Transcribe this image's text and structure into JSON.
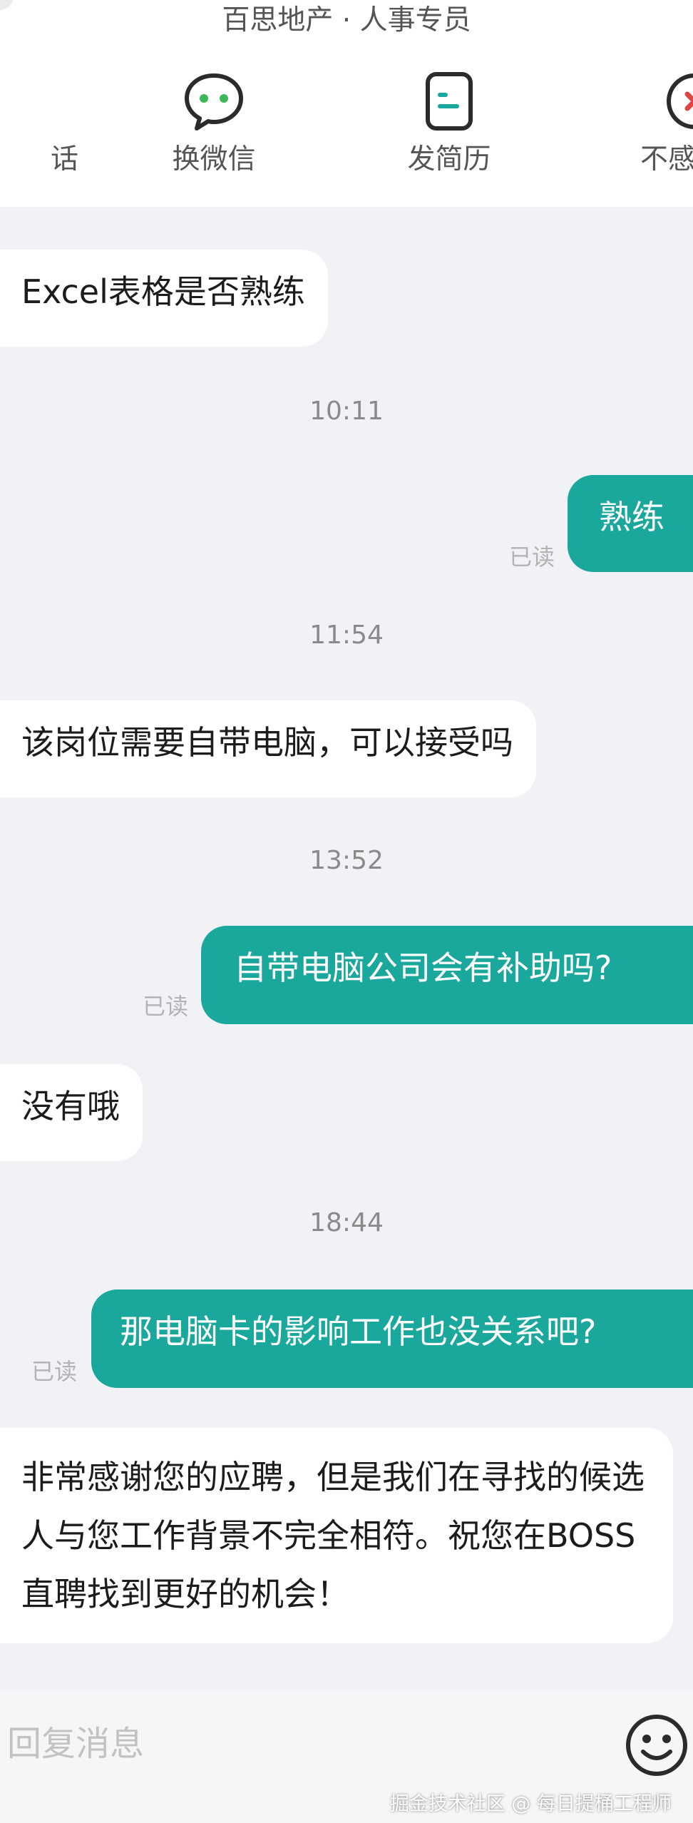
{
  "header": {
    "title": "百思地产 · 人事专员",
    "actions": [
      {
        "label": "话",
        "icon": "phone-icon"
      },
      {
        "label": "换微信",
        "icon": "wechat-icon"
      },
      {
        "label": "发简历",
        "icon": "resume-icon"
      },
      {
        "label": "不感",
        "icon": "not-interested-icon"
      }
    ]
  },
  "messages": [
    {
      "type": "incoming",
      "text": "Excel表格是否熟练"
    },
    {
      "type": "time",
      "text": "10:11"
    },
    {
      "type": "outgoing",
      "text": "熟练",
      "status": "已读"
    },
    {
      "type": "time",
      "text": "11:54"
    },
    {
      "type": "incoming",
      "text": "该岗位需要自带电脑，可以接受吗"
    },
    {
      "type": "time",
      "text": "13:52"
    },
    {
      "type": "outgoing",
      "text": "自带电脑公司会有补助吗?",
      "status": "已读"
    },
    {
      "type": "incoming",
      "text": "没有哦"
    },
    {
      "type": "time",
      "text": "18:44"
    },
    {
      "type": "outgoing",
      "text": "那电脑卡的影响工作也没关系吧?",
      "status": "已读"
    },
    {
      "type": "incoming",
      "text": "非常感谢您的应聘，但是我们在寻找的候选人与您工作背景不完全相符。祝您在BOSS直聘找到更好的机会！"
    }
  ],
  "input": {
    "placeholder": "回复消息"
  },
  "emoji_icon": "smile-icon",
  "watermark": "掘金技术社区 @ 每日提桶工程师",
  "colors": {
    "accent": "#1aa79c",
    "background": "#f1f2f6",
    "bubble_in": "#ffffff",
    "danger": "#e04545"
  }
}
